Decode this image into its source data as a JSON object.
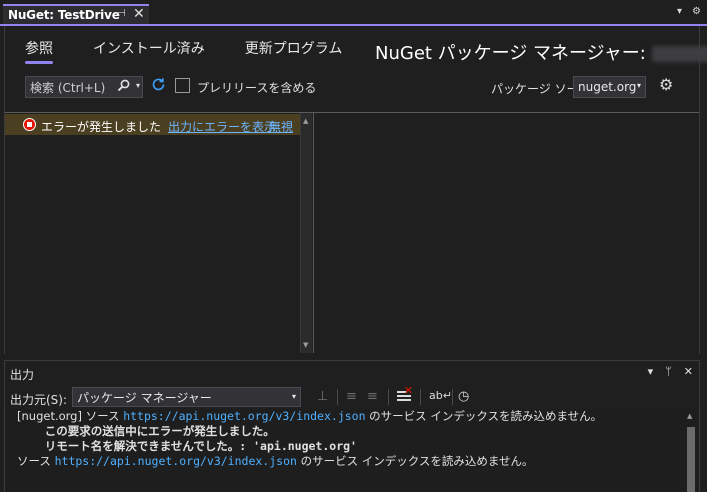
{
  "tab": {
    "title": "NuGet: TestDrive",
    "pin": "⊣",
    "close": "✕"
  },
  "strip": {
    "dropdown": "▾",
    "gear": "⚙"
  },
  "nav": {
    "browse": "参照",
    "installed": "インストール済み",
    "updates": "更新プログラム"
  },
  "manager_title": "NuGet パッケージ マネージャー:",
  "search": {
    "placeholder": "検索 (Ctrl+L)",
    "icon": "search-icon"
  },
  "prerelease_label": "プレリリースを含める",
  "source": {
    "label": "パッケージ ソース:",
    "value": "nuget.org"
  },
  "error": {
    "message": "エラーが発生しました",
    "show_link": "出力にエラーを表示",
    "ignore_link": "無視"
  },
  "output": {
    "title": "出力",
    "from_label": "出力元(S):",
    "from_value": "パッケージ マネージャー",
    "lines": [
      {
        "prefix": "[nuget.org] ソース ",
        "url": "https://api.nuget.org/v3/index.json",
        "suffix": " のサービス インデックスを読み込めません。"
      },
      {
        "text": "    この要求の送信中にエラーが発生しました。"
      },
      {
        "text": "    リモート名を解決できませんでした。: 'api.nuget.org'"
      },
      {
        "prefix": "ソース ",
        "url": "https://api.nuget.org/v3/index.json",
        "suffix": " のサービス インデックスを読み込めません。"
      }
    ]
  },
  "colors": {
    "accent": "#9184ee",
    "error_bar": "#4b3f21",
    "link": "#6cb4ff"
  }
}
